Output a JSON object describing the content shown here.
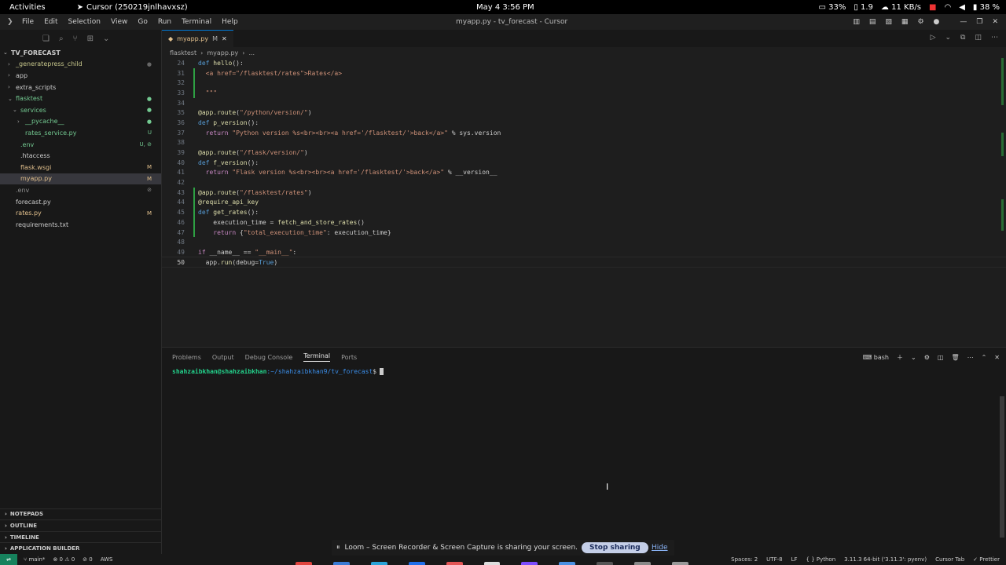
{
  "system": {
    "activities": "Activities",
    "app_name": "Cursor (250219jnlhavxsz)",
    "clock": "May 4  3:56 PM",
    "tray": {
      "cpu": "33%",
      "load": "1.9",
      "net": "11 KB/s",
      "battery": "38 %"
    }
  },
  "window": {
    "menu": [
      "File",
      "Edit",
      "Selection",
      "View",
      "Go",
      "Run",
      "Terminal",
      "Help"
    ],
    "title": "myapp.py - tv_forecast - Cursor"
  },
  "explorer": {
    "root": "TV_FORECAST",
    "items": [
      {
        "label": "_generatepress_child",
        "indent": 1,
        "chev": "›",
        "color": "#c5c58a",
        "badge": "●",
        "badge_color": "#666"
      },
      {
        "label": "app",
        "indent": 1,
        "chev": "›",
        "color": "#ccc",
        "badge": "",
        "badge_color": ""
      },
      {
        "label": "extra_scripts",
        "indent": 1,
        "chev": "›",
        "color": "#ccc",
        "badge": "",
        "badge_color": ""
      },
      {
        "label": "flasktest",
        "indent": 1,
        "chev": "⌄",
        "color": "#73c991",
        "badge": "●",
        "badge_color": "#73c991"
      },
      {
        "label": "services",
        "indent": 2,
        "chev": "⌄",
        "color": "#73c991",
        "badge": "●",
        "badge_color": "#73c991"
      },
      {
        "label": "__pycache__",
        "indent": 3,
        "chev": "›",
        "color": "#73c991",
        "badge": "●",
        "badge_color": "#73c991"
      },
      {
        "label": "rates_service.py",
        "indent": 3,
        "chev": "",
        "color": "#73c991",
        "badge": "U",
        "badge_color": "#73c991"
      },
      {
        "label": ".env",
        "indent": 2,
        "chev": "",
        "color": "#73c991",
        "badge": "U, ⊘",
        "badge_color": "#73c991"
      },
      {
        "label": ".htaccess",
        "indent": 2,
        "chev": "",
        "color": "#ccc",
        "badge": "",
        "badge_color": ""
      },
      {
        "label": "flask.wsgi",
        "indent": 2,
        "chev": "",
        "color": "#e2c08d",
        "badge": "M",
        "badge_color": "#e2c08d"
      },
      {
        "label": "myapp.py",
        "indent": 2,
        "chev": "",
        "color": "#e2c08d",
        "badge": "M",
        "badge_color": "#e2c08d",
        "selected": true
      },
      {
        "label": ".env",
        "indent": 1,
        "chev": "",
        "color": "#8c8c8c",
        "badge": "⊘",
        "badge_color": "#8c8c8c"
      },
      {
        "label": "forecast.py",
        "indent": 1,
        "chev": "",
        "color": "#ccc",
        "badge": "",
        "badge_color": ""
      },
      {
        "label": "rates.py",
        "indent": 1,
        "chev": "",
        "color": "#e2c08d",
        "badge": "M",
        "badge_color": "#e2c08d"
      },
      {
        "label": "requirements.txt",
        "indent": 1,
        "chev": "",
        "color": "#ccc",
        "badge": "",
        "badge_color": ""
      }
    ],
    "sections": [
      "NOTEPADS",
      "OUTLINE",
      "TIMELINE",
      "APPLICATION BUILDER"
    ]
  },
  "editor": {
    "tab_label": "myapp.py",
    "tab_modified": "M",
    "breadcrumb": [
      "flasktest",
      "myapp.py",
      "..."
    ],
    "lines": [
      {
        "n": "24",
        "tokens": [
          [
            "kw",
            "def "
          ],
          [
            "fn",
            "hello"
          ],
          [
            "txt",
            "():"
          ]
        ]
      },
      {
        "n": "31",
        "tokens": [
          [
            "txt",
            "  "
          ],
          [
            "str",
            "<a href=\"/flasktest/rates\">Rates</a>"
          ]
        ],
        "git": true
      },
      {
        "n": "32",
        "tokens": [],
        "git": true
      },
      {
        "n": "33",
        "tokens": [
          [
            "txt",
            "  "
          ],
          [
            "str",
            "\"\"\""
          ]
        ],
        "git": true
      },
      {
        "n": "34",
        "tokens": []
      },
      {
        "n": "35",
        "tokens": [
          [
            "fn",
            "@app.route"
          ],
          [
            "txt",
            "("
          ],
          [
            "str",
            "\"/python/version/\""
          ],
          [
            "txt",
            ")"
          ]
        ]
      },
      {
        "n": "36",
        "tokens": [
          [
            "kw",
            "def "
          ],
          [
            "fn",
            "p_version"
          ],
          [
            "txt",
            "():"
          ]
        ]
      },
      {
        "n": "37",
        "tokens": [
          [
            "txt",
            "  "
          ],
          [
            "kw2",
            "return "
          ],
          [
            "str",
            "\"Python version %s<br><br><a href='/flasktest/'>back</a>\""
          ],
          [
            "txt",
            " % sys.version"
          ]
        ]
      },
      {
        "n": "38",
        "tokens": []
      },
      {
        "n": "39",
        "tokens": [
          [
            "fn",
            "@app.route"
          ],
          [
            "txt",
            "("
          ],
          [
            "str",
            "\"/flask/version/\""
          ],
          [
            "txt",
            ")"
          ]
        ]
      },
      {
        "n": "40",
        "tokens": [
          [
            "kw",
            "def "
          ],
          [
            "fn",
            "f_version"
          ],
          [
            "txt",
            "():"
          ]
        ]
      },
      {
        "n": "41",
        "tokens": [
          [
            "txt",
            "  "
          ],
          [
            "kw2",
            "return "
          ],
          [
            "str",
            "\"Flask version %s<br><br><a href='/flasktest/'>back</a>\""
          ],
          [
            "txt",
            " % __version__"
          ]
        ]
      },
      {
        "n": "42",
        "tokens": []
      },
      {
        "n": "43",
        "tokens": [
          [
            "fn",
            "@app.route"
          ],
          [
            "txt",
            "("
          ],
          [
            "str",
            "\"/flasktest/rates\""
          ],
          [
            "txt",
            ")"
          ]
        ],
        "git": true
      },
      {
        "n": "44",
        "tokens": [
          [
            "fn",
            "@require_api_key"
          ]
        ],
        "git": true
      },
      {
        "n": "45",
        "tokens": [
          [
            "kw",
            "def "
          ],
          [
            "fn",
            "get_rates"
          ],
          [
            "txt",
            "():"
          ]
        ],
        "git": true
      },
      {
        "n": "46",
        "tokens": [
          [
            "txt",
            "    execution_time = "
          ],
          [
            "fn",
            "fetch_and_store_rates"
          ],
          [
            "txt",
            "()"
          ]
        ],
        "git": true
      },
      {
        "n": "47",
        "tokens": [
          [
            "txt",
            "    "
          ],
          [
            "kw2",
            "return "
          ],
          [
            "txt",
            "{"
          ],
          [
            "str",
            "\"total_execution_time\""
          ],
          [
            "txt",
            ": execution_time}"
          ]
        ],
        "git": true
      },
      {
        "n": "48",
        "tokens": []
      },
      {
        "n": "49",
        "tokens": [
          [
            "kw2",
            "if "
          ],
          [
            "txt",
            "__name__ == "
          ],
          [
            "str",
            "\"__main__\""
          ],
          [
            "txt",
            ":"
          ]
        ]
      },
      {
        "n": "50",
        "tokens": [
          [
            "txt",
            "  app."
          ],
          [
            "fn",
            "run"
          ],
          [
            "txt",
            "(debug="
          ],
          [
            "kw",
            "True"
          ],
          [
            "txt",
            ")"
          ]
        ],
        "current": true
      }
    ]
  },
  "panel": {
    "tabs": [
      "Problems",
      "Output",
      "Debug Console",
      "Terminal",
      "Ports"
    ],
    "active_tab": "Terminal",
    "shell": "bash",
    "prompt_user": "shahzaibkhan@shahzaibkhan",
    "prompt_path": ":~/shahzaibkhan9/tv_forecast",
    "prompt_end": "$"
  },
  "statusbar": {
    "branch": "main*",
    "errors": "⊗ 0 ⚠ 0",
    "ports": "⊘ 0",
    "aws": "AWS",
    "right": [
      "Spaces: 2",
      "UTF-8",
      "LF",
      "{ } Python",
      "3.11.3 64-bit ('3.11.3': pyenv)",
      "Cursor Tab",
      "✓ Prettier"
    ]
  },
  "loom": {
    "message": "Loom – Screen Recorder & Screen Capture is sharing your screen.",
    "stop_label": "Stop sharing",
    "hide_label": "Hide"
  },
  "colors": {
    "accent": "#0078d4",
    "remote": "#16825d",
    "git_added": "#2ea043"
  },
  "dock_colors": [
    "#e0443e",
    "#3a7bd5",
    "#2aa3d8",
    "#1f6feb",
    "#e25555",
    "#dddddd",
    "#7c4dff",
    "#4a90e2",
    "#555555",
    "#888888",
    "#999999"
  ]
}
